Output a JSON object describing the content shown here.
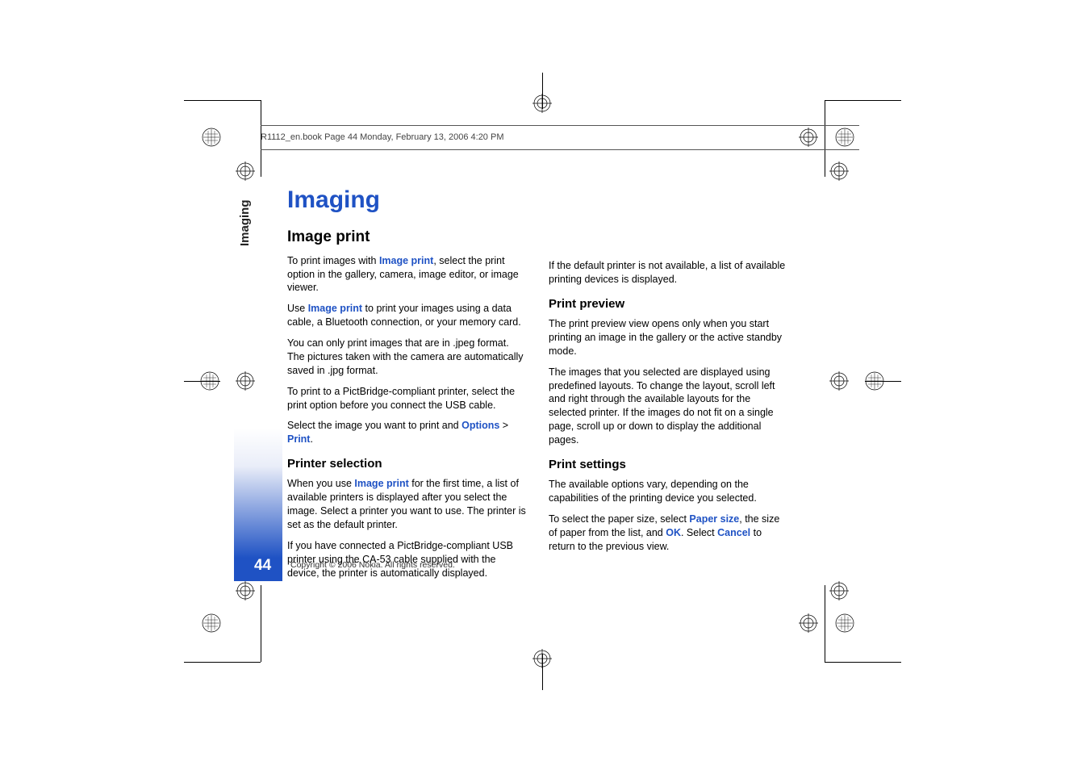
{
  "runningHead": "R1112_en.book  Page 44  Monday, February 13, 2006  4:20 PM",
  "sideTab": "Imaging",
  "pageNumber": "44",
  "copyright": "Copyright © 2006 Nokia. All rights reserved.",
  "title": "Imaging",
  "left": {
    "h2": "Image print",
    "p1a": "To print images with ",
    "p1k": "Image print",
    "p1b": ", select the print option in the gallery, camera, image editor, or image viewer.",
    "p2a": "Use ",
    "p2k": "Image print",
    "p2b": " to print your images using a data cable, a Bluetooth connection, or your memory card.",
    "p3": "You can only print images that are in .jpeg format. The pictures taken with the camera are automatically saved in .jpg format.",
    "p4": "To print to a PictBridge-compliant printer, select the print option before you connect the USB cable.",
    "p5a": "Select the image you want to print and ",
    "p5k1": "Options",
    "p5mid": " > ",
    "p5k2": "Print",
    "p5end": ".",
    "h3a": "Printer selection",
    "p6a": "When you use ",
    "p6k": "Image print",
    "p6b": " for the first time, a list of available printers is displayed after you select the image. Select a printer you want to use. The printer is set as the default printer.",
    "p7": "If you have connected a PictBridge-compliant USB printer using the CA-53 cable supplied with the device, the printer is automatically displayed."
  },
  "right": {
    "p1": "If the default printer is not available, a list of available printing devices is displayed.",
    "h3a": "Print preview",
    "p2": "The print preview view opens only when you start printing an image in the gallery or the active standby mode.",
    "p3": "The images that you selected are displayed using predefined layouts. To change the layout, scroll left and right through the available layouts for the selected printer. If the images do not fit on a single page, scroll up or down to display the additional pages.",
    "h3b": "Print settings",
    "p4": "The available options vary, depending on the capabilities of the printing device you selected.",
    "p5a": "To select the paper size, select ",
    "p5k1": "Paper size",
    "p5b": ", the size of paper from the list, and ",
    "p5k2": "OK",
    "p5c": ". Select ",
    "p5k3": "Cancel",
    "p5d": " to return to the previous view."
  }
}
